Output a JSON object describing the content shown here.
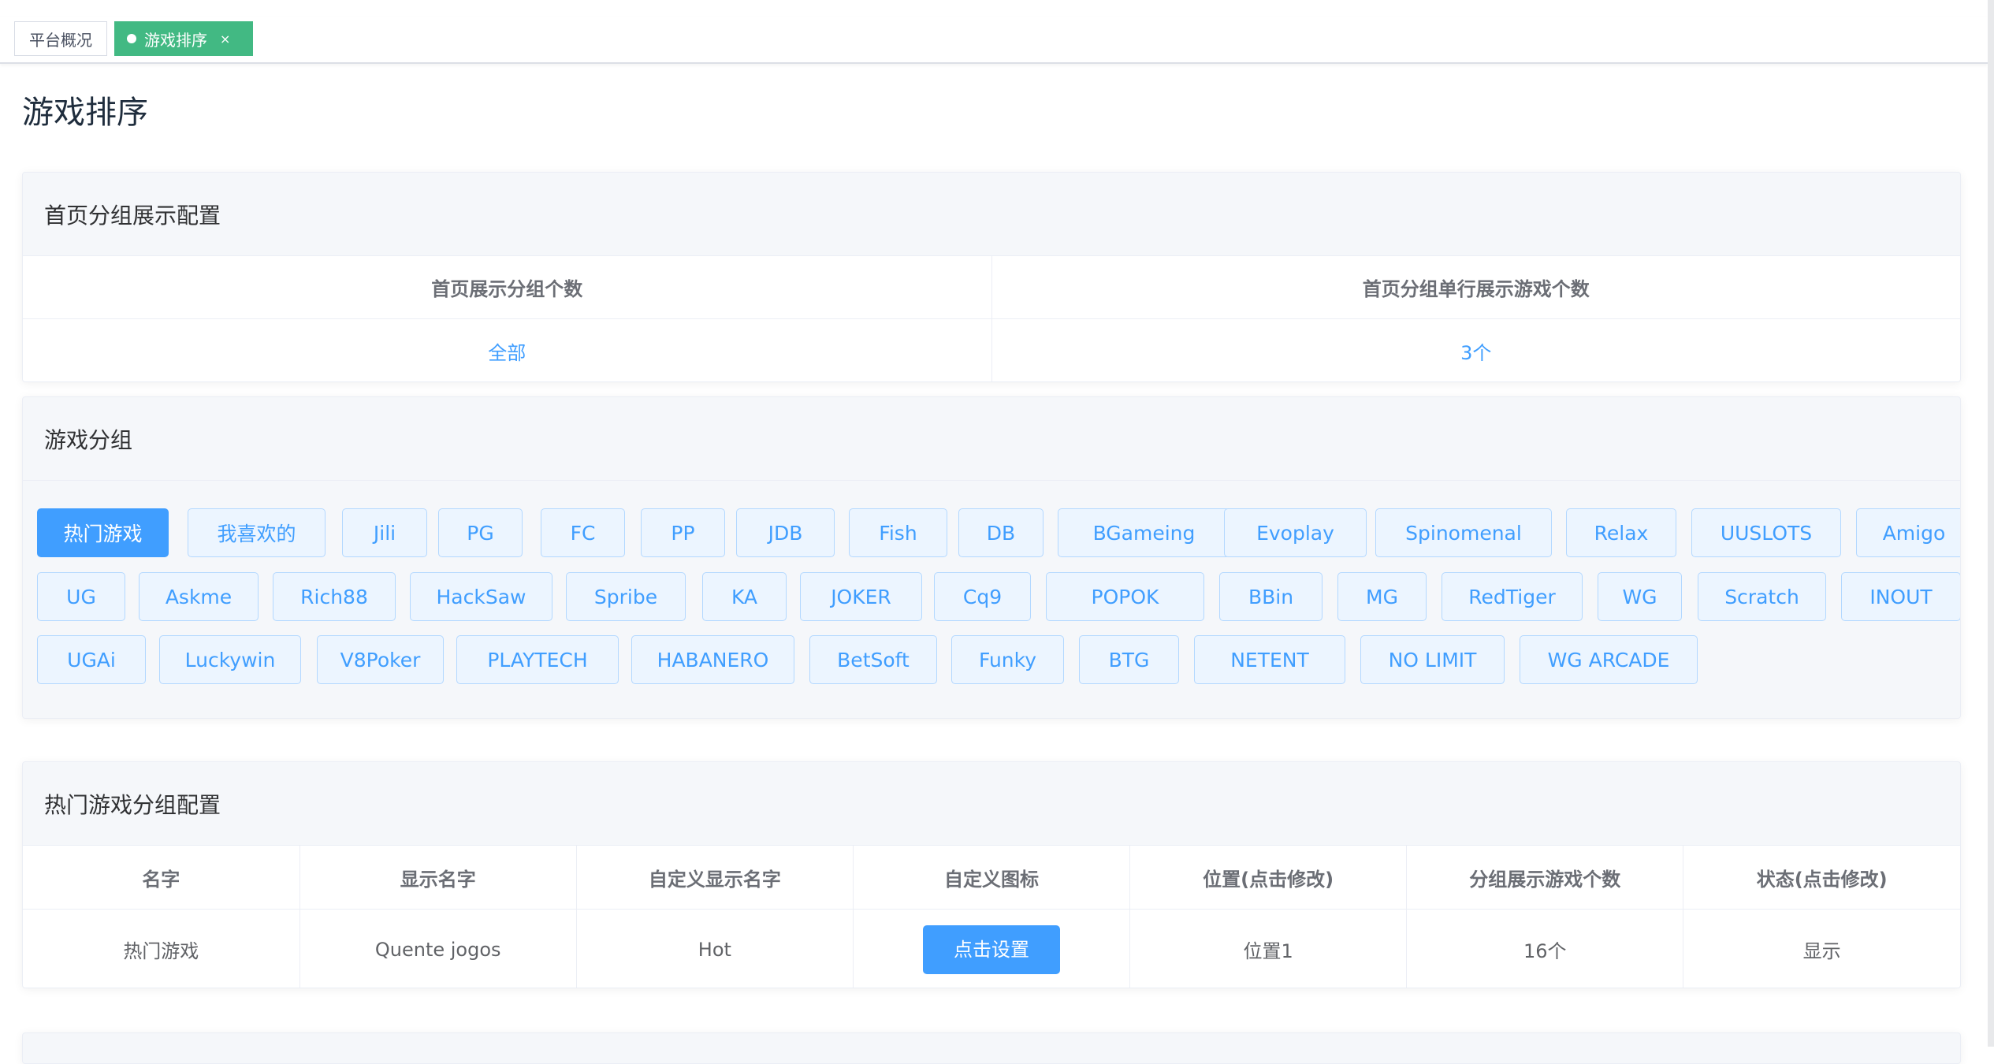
{
  "tabs": [
    {
      "label": "平台概况"
    },
    {
      "label": "游戏排序",
      "close": "×"
    }
  ],
  "page_title": "游戏排序",
  "homepage_config": {
    "title": "首页分组展示配置",
    "headers": [
      "首页展示分组个数",
      "首页分组单行展示游戏个数"
    ],
    "values": [
      "全部",
      "3个"
    ]
  },
  "game_groups": {
    "title": "游戏分组",
    "items": [
      "热门游戏",
      "我喜欢的",
      "Jili",
      "PG",
      "FC",
      "PP",
      "JDB",
      "Fish",
      "DB",
      "BGameing",
      "Evoplay",
      "Spinomenal",
      "Relax",
      "UUSLOTS",
      "Amigo",
      "UG",
      "Askme",
      "Rich88",
      "HackSaw",
      "Spribe",
      "KA",
      "JOKER",
      "Cq9",
      "POPOK",
      "BBin",
      "MG",
      "RedTiger",
      "WG",
      "Scratch",
      "INOUT",
      "UGAi",
      "Luckywin",
      "V8Poker",
      "PLAYTECH",
      "HABANERO",
      "BetSoft",
      "Funky",
      "BTG",
      "NETENT",
      "NO LIMIT",
      "WG ARCADE"
    ],
    "active_index": 0
  },
  "hot_config": {
    "title": "热门游戏分组配置",
    "headers": [
      "名字",
      "显示名字",
      "自定义显示名字",
      "自定义图标",
      "位置(点击修改)",
      "分组展示游戏个数",
      "状态(点击修改)"
    ],
    "row": {
      "name": "热门游戏",
      "display_name": "Quente jogos",
      "custom_name": "Hot",
      "icon_button": "点击设置",
      "position": "位置1",
      "count": "16个",
      "status": "显示"
    }
  },
  "colors": {
    "accent": "#409eff",
    "tag_active": "#42b983",
    "status_green": "#2b8a1e"
  }
}
